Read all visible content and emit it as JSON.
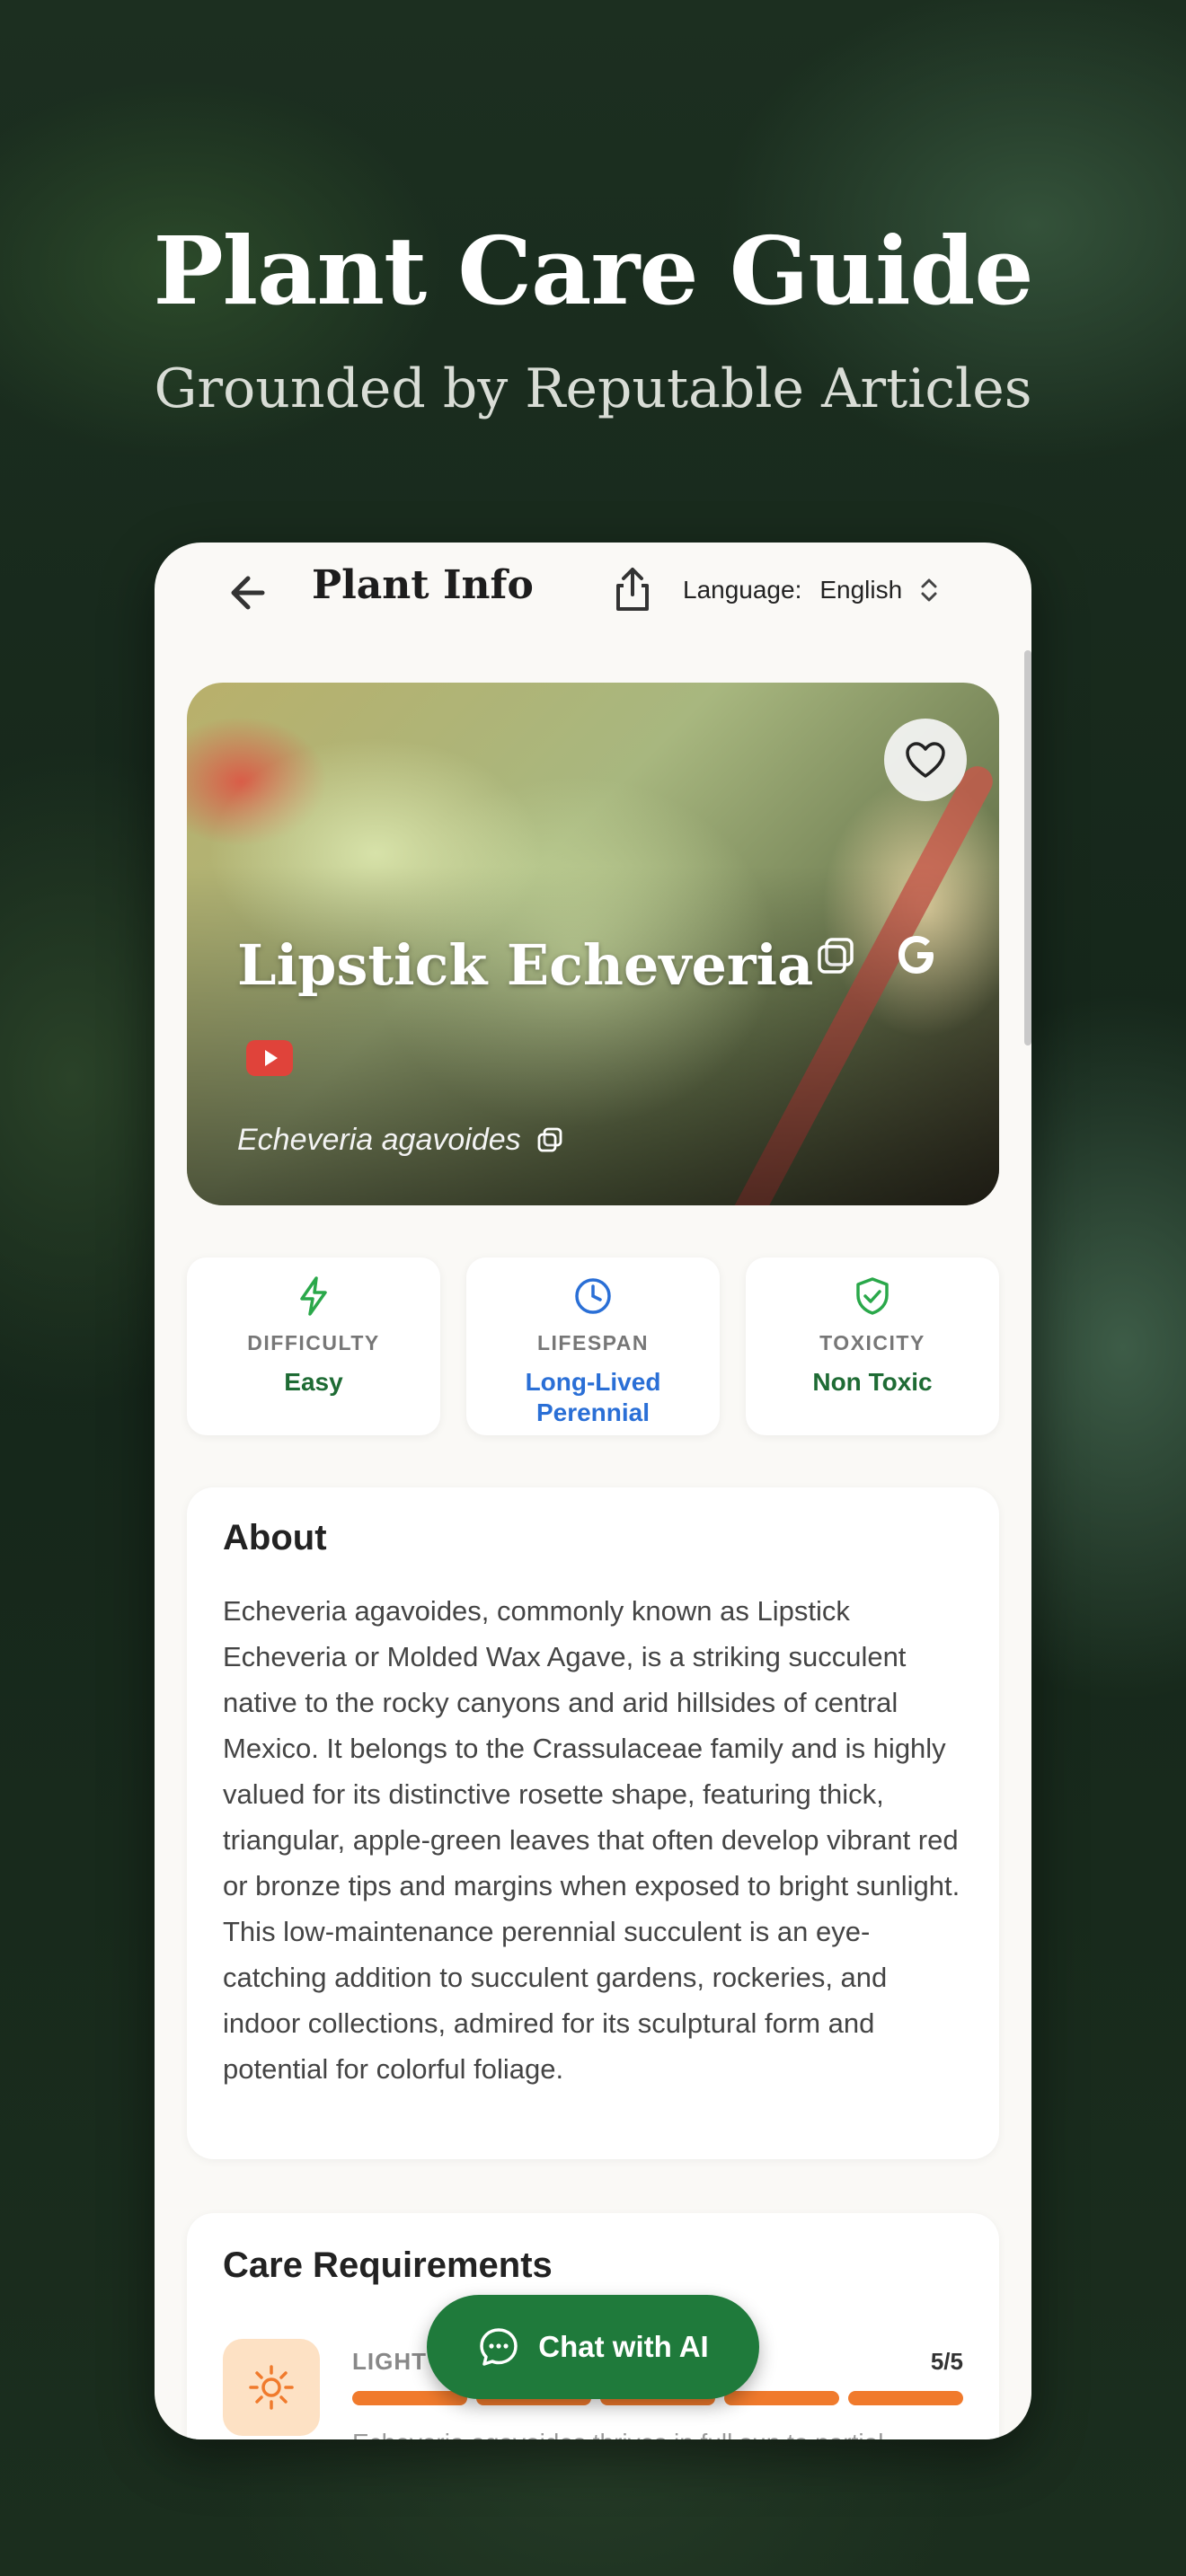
{
  "hero": {
    "title": "Plant Care Guide",
    "subtitle": "Grounded by Reputable Articles"
  },
  "topbar": {
    "title": "Plant Info",
    "language_label": "Language:",
    "language_value": "English"
  },
  "plant": {
    "common_name": "Lipstick Echeveria",
    "scientific_name": "Echeveria agavoides"
  },
  "stats": [
    {
      "label": "DIFFICULTY",
      "value": "Easy",
      "icon": "lightning-icon",
      "color": "#1e6b34"
    },
    {
      "label": "LIFESPAN",
      "value": "Long-Lived Perennial",
      "icon": "clock-icon",
      "color": "#2a6fd6"
    },
    {
      "label": "TOXICITY",
      "value": "Non Toxic",
      "icon": "shield-check-icon",
      "color": "#1e6b34"
    }
  ],
  "about": {
    "heading": "About",
    "text": "Echeveria agavoides, commonly known as Lipstick Echeveria or Molded Wax Agave, is a striking succulent native to the rocky canyons and arid hillsides of central Mexico. It belongs to the Crassulaceae family and is highly valued for its distinctive rosette shape, featuring thick, triangular, apple-green leaves that often develop vibrant red or bronze tips and margins when exposed to bright sunlight. This low-maintenance perennial succulent is an eye-catching addition to succulent gardens, rockeries, and indoor collections, admired for its sculptural form and potential for colorful foliage."
  },
  "care": {
    "heading": "Care Requirements",
    "light_label": "LIGHT",
    "light_score": "5/5",
    "light_level": 5,
    "light_max": 5,
    "light_desc": "Echeveria agavoides thrives in full sun to partial"
  },
  "chat": {
    "label": "Chat with AI"
  },
  "colors": {
    "accent_green": "#1f7a3b",
    "light_orange": "#f07a2c"
  }
}
